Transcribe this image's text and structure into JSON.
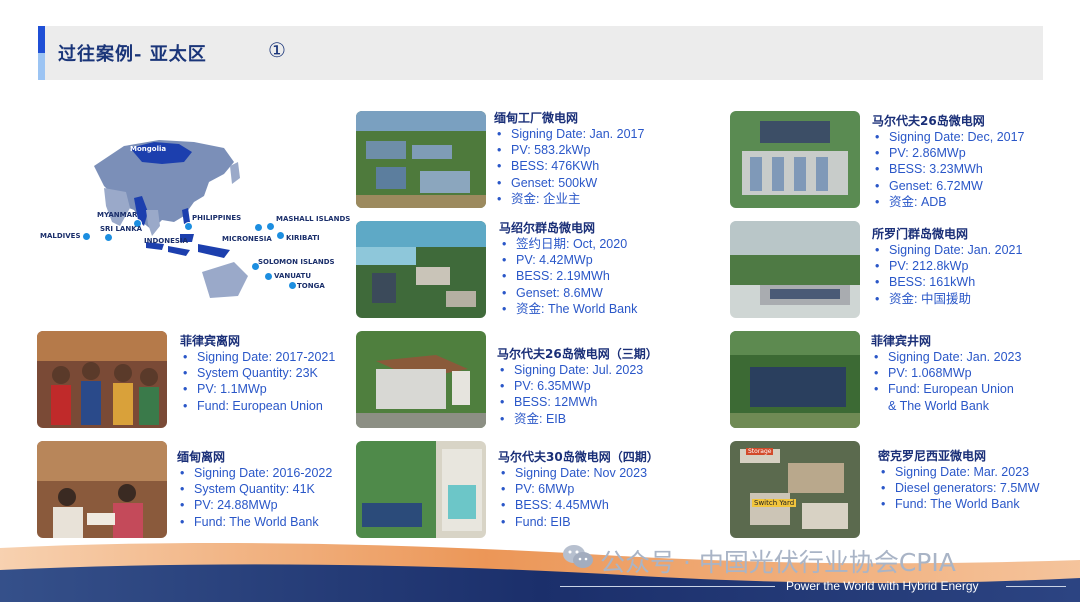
{
  "header": {
    "title": "过往案例- 亚太区",
    "page_number": "①"
  },
  "map": {
    "labels": [
      {
        "key": "mongolia",
        "text": "Mongolia"
      },
      {
        "key": "myanmar",
        "text": "MYANMAR"
      },
      {
        "key": "srilanka",
        "text": "SRI LANKA"
      },
      {
        "key": "maldives",
        "text": "MALDIVES"
      },
      {
        "key": "indonesia",
        "text": "INDONESIA"
      },
      {
        "key": "philippines",
        "text": "PHILIPPINES"
      },
      {
        "key": "micronesia",
        "text": "MICRONESIA"
      },
      {
        "key": "marshall",
        "text": "MASHALL ISLANDS"
      },
      {
        "key": "kiribati",
        "text": "KIRIBATI"
      },
      {
        "key": "solomon",
        "text": "SOLOMON ISLANDS"
      },
      {
        "key": "vanuatu",
        "text": "VANUATU"
      },
      {
        "key": "tonga",
        "text": "TONGA"
      }
    ]
  },
  "cases": [
    {
      "title": "缅甸工厂微电网",
      "items": [
        "Signing Date: Jan. 2017",
        "PV: 583.2kWp",
        "BESS: 476KWh",
        "Genset: 500kW",
        "资金: 企业主"
      ]
    },
    {
      "title": "马绍尔群岛微电网",
      "items": [
        "签约日期: Oct, 2020",
        "PV: 4.42MWp",
        "BESS: 2.19MWh",
        "Genset: 8.6MW",
        "资金: The World Bank"
      ]
    },
    {
      "title": "马尔代夫26岛微电网（三期）",
      "items": [
        "Signing Date: Jul. 2023",
        "PV: 6.35MWp",
        "BESS: 12MWh",
        "资金: EIB"
      ]
    },
    {
      "title": "马尔代夫30岛微电网（四期）",
      "items": [
        "Signing Date: Nov 2023",
        "PV: 6MWp",
        "BESS: 4.45MWh",
        "Fund: EIB"
      ]
    },
    {
      "title": "马尔代夫26岛微电网",
      "items": [
        "Signing Date: Dec, 2017",
        "PV: 2.86MWp",
        "BESS: 3.23MWh",
        "Genset: 6.72MW",
        "资金: ADB"
      ]
    },
    {
      "title": "所罗门群岛微电网",
      "items": [
        "Signing Date: Jan. 2021",
        "PV: 212.8kWp",
        "BESS: 161kWh",
        "资金: 中国援助"
      ]
    },
    {
      "title": "菲律宾井网",
      "items": [
        "Signing Date: Jan. 2023",
        "PV: 1.068MWp",
        "Fund: European Union"
      ],
      "cont": "& The World Bank"
    },
    {
      "title": "密克罗尼西亚微电网",
      "items": [
        "Signing Date: Mar. 2023",
        "Diesel generators: 7.5MW",
        "Fund: The World Bank"
      ]
    },
    {
      "title": "菲律宾离网",
      "items": [
        "Signing Date: 2017-2021",
        "System Quantity: 23K",
        "PV: 1.1MWp",
        "Fund: European Union"
      ]
    },
    {
      "title": "缅甸离网",
      "items": [
        "Signing Date: 2016-2022",
        "System Quantity: 41K",
        "PV: 24.88MWp",
        "Fund: The World Bank"
      ]
    }
  ],
  "photo_labels": {
    "storage": "Storage",
    "switch_yard": "Switch Yard"
  },
  "footer": {
    "watermark": "公众号 · 中国光伏行业协会CPIA",
    "slogan": "Power the World with Hybrid Energy"
  },
  "colors": {
    "title": "#1a3579",
    "text": "#2a57c8",
    "accent": "#1f4fd6",
    "pin": "#1c8ee0",
    "footer_orange": "#e8843a",
    "footer_navy": "#1b2f6b"
  }
}
